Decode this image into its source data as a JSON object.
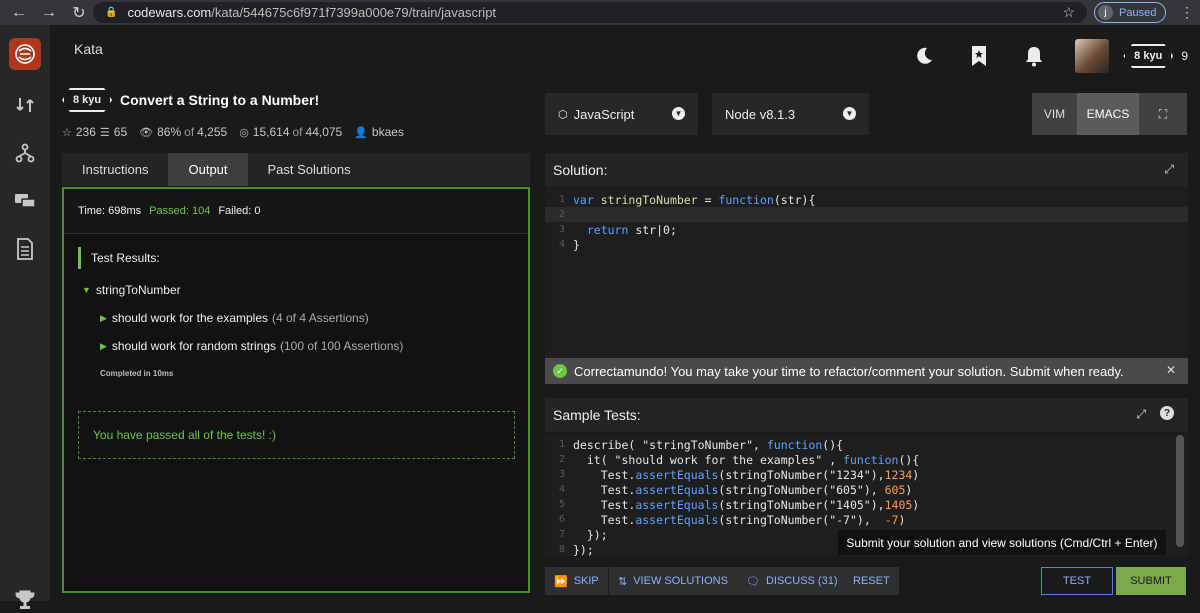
{
  "browser": {
    "url_host": "codewars.com",
    "url_path": "/kata/544675c6f971f7399a000e79/train/javascript",
    "profile_letter": "j",
    "profile_status": "Paused"
  },
  "topbar": {
    "title": "Kata",
    "rank": "8 kyu",
    "honor": "9"
  },
  "kata": {
    "rank": "8 kyu",
    "title": "Convert a String to a Number!",
    "stars": "236",
    "collections": "65",
    "satisfaction": "86%",
    "satisfaction_of": "of",
    "satisfaction_total": "4,255",
    "completed": "15,614",
    "completed_of": "of",
    "completed_total": "44,075",
    "author": "bkaes"
  },
  "left_tabs": [
    {
      "label": "Instructions"
    },
    {
      "label": "Output"
    },
    {
      "label": "Past Solutions"
    }
  ],
  "output": {
    "time_label": "Time: 698ms",
    "passed_label": "Passed: 104",
    "failed_label": "Failed: 0",
    "results_heading": "Test Results:",
    "describe": "stringToNumber",
    "it_1": "should work for the examples",
    "it_1_assert": "(4 of 4 Assertions)",
    "it_2": "should work for random strings",
    "it_2_assert": "(100 of 100 Assertions)",
    "completed": "Completed in 10ms",
    "passed_all": "You have passed all of the tests! :)"
  },
  "toolbar": {
    "language": "JavaScript",
    "runtime": "Node v8.1.3",
    "modes": [
      "VIM",
      "EMACS"
    ]
  },
  "solution": {
    "heading": "Solution:",
    "line_numbers": [
      "1",
      "2",
      "3",
      "4"
    ]
  },
  "success_message": "Correctamundo! You may take your time to refactor/comment your solution. Submit when ready.",
  "sample_tests": {
    "heading": "Sample Tests:",
    "line_numbers": [
      "1",
      "2",
      "3",
      "4",
      "5",
      "6",
      "7",
      "8"
    ]
  },
  "tooltip": "Submit your solution and view solutions (Cmd/Ctrl + Enter)",
  "actions": {
    "skip": "SKIP",
    "view_solutions": "VIEW SOLUTIONS",
    "discuss": "DISCUSS (31)",
    "reset": "RESET",
    "test": "TEST",
    "submit": "SUBMIT"
  }
}
